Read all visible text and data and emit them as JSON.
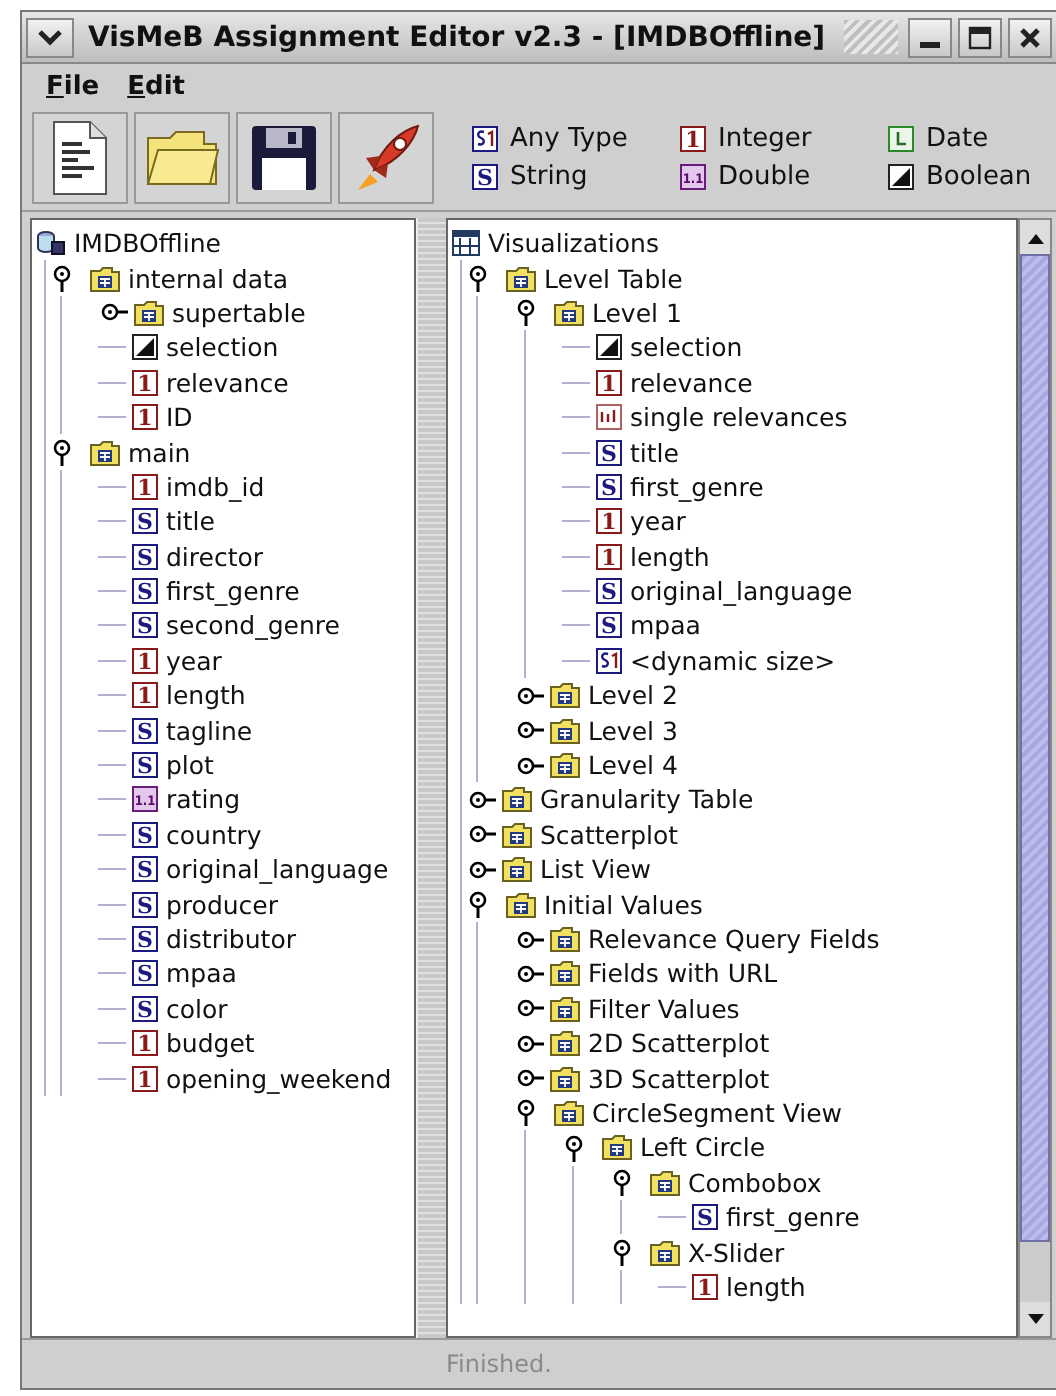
{
  "window": {
    "title": "VisMeB Assignment Editor v2.3 - [IMDBOffline]"
  },
  "menu": [
    "File",
    "Edit"
  ],
  "toolbar": [
    {
      "kind": "new"
    },
    {
      "kind": "open"
    },
    {
      "kind": "save"
    },
    {
      "kind": "run"
    }
  ],
  "legend": [
    {
      "kind": "any",
      "label": "Any Type"
    },
    {
      "kind": "integer",
      "glyph": "1",
      "label": "Integer"
    },
    {
      "kind": "date",
      "label": "Date"
    },
    {
      "kind": "string",
      "glyph": "S",
      "label": "String"
    },
    {
      "kind": "double",
      "glyph": "1.1",
      "label": "Double"
    },
    {
      "kind": "boolean",
      "label": "Boolean"
    }
  ],
  "data_tree": {
    "label": "IMDBOffline",
    "kind": "database",
    "children": [
      {
        "label": "internal data",
        "kind": "table",
        "expanded": true,
        "children": [
          {
            "label": "supertable",
            "kind": "table",
            "expanded": false
          },
          {
            "label": "selection",
            "kind": "boolean"
          },
          {
            "label": "relevance",
            "kind": "integer",
            "glyph": "1"
          },
          {
            "label": "ID",
            "kind": "integer",
            "glyph": "1"
          }
        ]
      },
      {
        "label": "main",
        "kind": "table",
        "expanded": true,
        "children": [
          {
            "label": "imdb_id",
            "kind": "integer",
            "glyph": "1"
          },
          {
            "label": "title",
            "kind": "string",
            "glyph": "S"
          },
          {
            "label": "director",
            "kind": "string",
            "glyph": "S"
          },
          {
            "label": "first_genre",
            "kind": "string",
            "glyph": "S"
          },
          {
            "label": "second_genre",
            "kind": "string",
            "glyph": "S"
          },
          {
            "label": "year",
            "kind": "integer",
            "glyph": "1"
          },
          {
            "label": "length",
            "kind": "integer",
            "glyph": "1"
          },
          {
            "label": "tagline",
            "kind": "string",
            "glyph": "S"
          },
          {
            "label": "plot",
            "kind": "string",
            "glyph": "S"
          },
          {
            "label": "rating",
            "kind": "double",
            "glyph": "1.1"
          },
          {
            "label": "country",
            "kind": "string",
            "glyph": "S"
          },
          {
            "label": "original_language",
            "kind": "string",
            "glyph": "S"
          },
          {
            "label": "producer",
            "kind": "string",
            "glyph": "S"
          },
          {
            "label": "distributor",
            "kind": "string",
            "glyph": "S"
          },
          {
            "label": "mpaa",
            "kind": "string",
            "glyph": "S"
          },
          {
            "label": "color",
            "kind": "string",
            "glyph": "S"
          },
          {
            "label": "budget",
            "kind": "integer",
            "glyph": "1"
          },
          {
            "label": "opening_weekend",
            "kind": "integer",
            "glyph": "1"
          }
        ]
      }
    ]
  },
  "visualization_tree": {
    "label": "Visualizations",
    "kind": "visualizations",
    "children": [
      {
        "label": "Level Table",
        "kind": "table",
        "expanded": true,
        "children": [
          {
            "label": "Level 1",
            "kind": "table",
            "expanded": true,
            "children": [
              {
                "label": "selection",
                "kind": "boolean"
              },
              {
                "label": "relevance",
                "kind": "integer",
                "glyph": "1"
              },
              {
                "label": "single relevances",
                "kind": "relevances"
              },
              {
                "label": "title",
                "kind": "string",
                "glyph": "S"
              },
              {
                "label": "first_genre",
                "kind": "string",
                "glyph": "S"
              },
              {
                "label": "year",
                "kind": "integer",
                "glyph": "1"
              },
              {
                "label": "length",
                "kind": "integer",
                "glyph": "1"
              },
              {
                "label": "original_language",
                "kind": "string",
                "glyph": "S"
              },
              {
                "label": "mpaa",
                "kind": "string",
                "glyph": "S"
              },
              {
                "label": "<dynamic size>",
                "kind": "any"
              }
            ]
          },
          {
            "label": "Level 2",
            "kind": "table",
            "expanded": false
          },
          {
            "label": "Level 3",
            "kind": "table",
            "expanded": false
          },
          {
            "label": "Level 4",
            "kind": "table",
            "expanded": false
          }
        ]
      },
      {
        "label": "Granularity Table",
        "kind": "table",
        "expanded": false
      },
      {
        "label": "Scatterplot",
        "kind": "table",
        "expanded": false
      },
      {
        "label": "List View",
        "kind": "table",
        "expanded": false
      },
      {
        "label": "Initial Values",
        "kind": "table",
        "expanded": true,
        "children": [
          {
            "label": "Relevance Query Fields",
            "kind": "table",
            "expanded": false
          },
          {
            "label": "Fields with URL",
            "kind": "table",
            "expanded": false
          },
          {
            "label": "Filter Values",
            "kind": "table",
            "expanded": false
          },
          {
            "label": "2D Scatterplot",
            "kind": "table",
            "expanded": false
          },
          {
            "label": "3D Scatterplot",
            "kind": "table",
            "expanded": false
          },
          {
            "label": "CircleSegment View",
            "kind": "table",
            "expanded": true,
            "children": [
              {
                "label": "Left Circle",
                "kind": "table",
                "expanded": true,
                "children": [
                  {
                    "label": "Combobox",
                    "kind": "table",
                    "expanded": true,
                    "children": [
                      {
                        "label": "first_genre",
                        "kind": "string",
                        "glyph": "S"
                      }
                    ]
                  },
                  {
                    "label": "X-Slider",
                    "kind": "table",
                    "expanded": true,
                    "children": [
                      {
                        "label": "length",
                        "kind": "integer",
                        "glyph": "1"
                      }
                    ]
                  }
                ]
              }
            ]
          }
        ]
      }
    ]
  },
  "status_bar": {
    "text": "Finished.",
    "disabled": true
  }
}
